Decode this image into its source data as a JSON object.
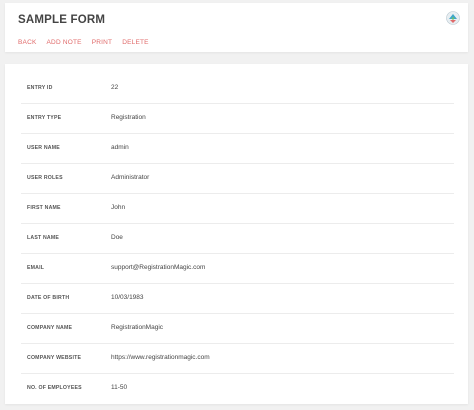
{
  "header": {
    "title": "SAMPLE FORM",
    "logo_icon": "registrationmagic-logo-icon",
    "actions": [
      {
        "label": "BACK"
      },
      {
        "label": "ADD NOTE"
      },
      {
        "label": "PRINT"
      },
      {
        "label": "DELETE"
      }
    ]
  },
  "fields": [
    {
      "label": "ENTRY ID",
      "value": "22"
    },
    {
      "label": "ENTRY TYPE",
      "value": "Registration"
    },
    {
      "label": "USER NAME",
      "value": "admin"
    },
    {
      "label": "USER ROLES",
      "value": "Administrator"
    },
    {
      "label": "FIRST NAME",
      "value": "John"
    },
    {
      "label": "LAST NAME",
      "value": "Doe"
    },
    {
      "label": "EMAIL",
      "value": "support@RegistrationMagic.com"
    },
    {
      "label": "DATE OF BIRTH",
      "value": "10/03/1983"
    },
    {
      "label": "COMPANY NAME",
      "value": "RegistrationMagic"
    },
    {
      "label": "COMPANY WEBSITE",
      "value": "https://www.registrationmagic.com"
    },
    {
      "label": "NO. OF EMPLOYEES",
      "value": "11-50"
    }
  ],
  "colors": {
    "accent": "#e06a6a",
    "background": "#f1f1f1"
  }
}
